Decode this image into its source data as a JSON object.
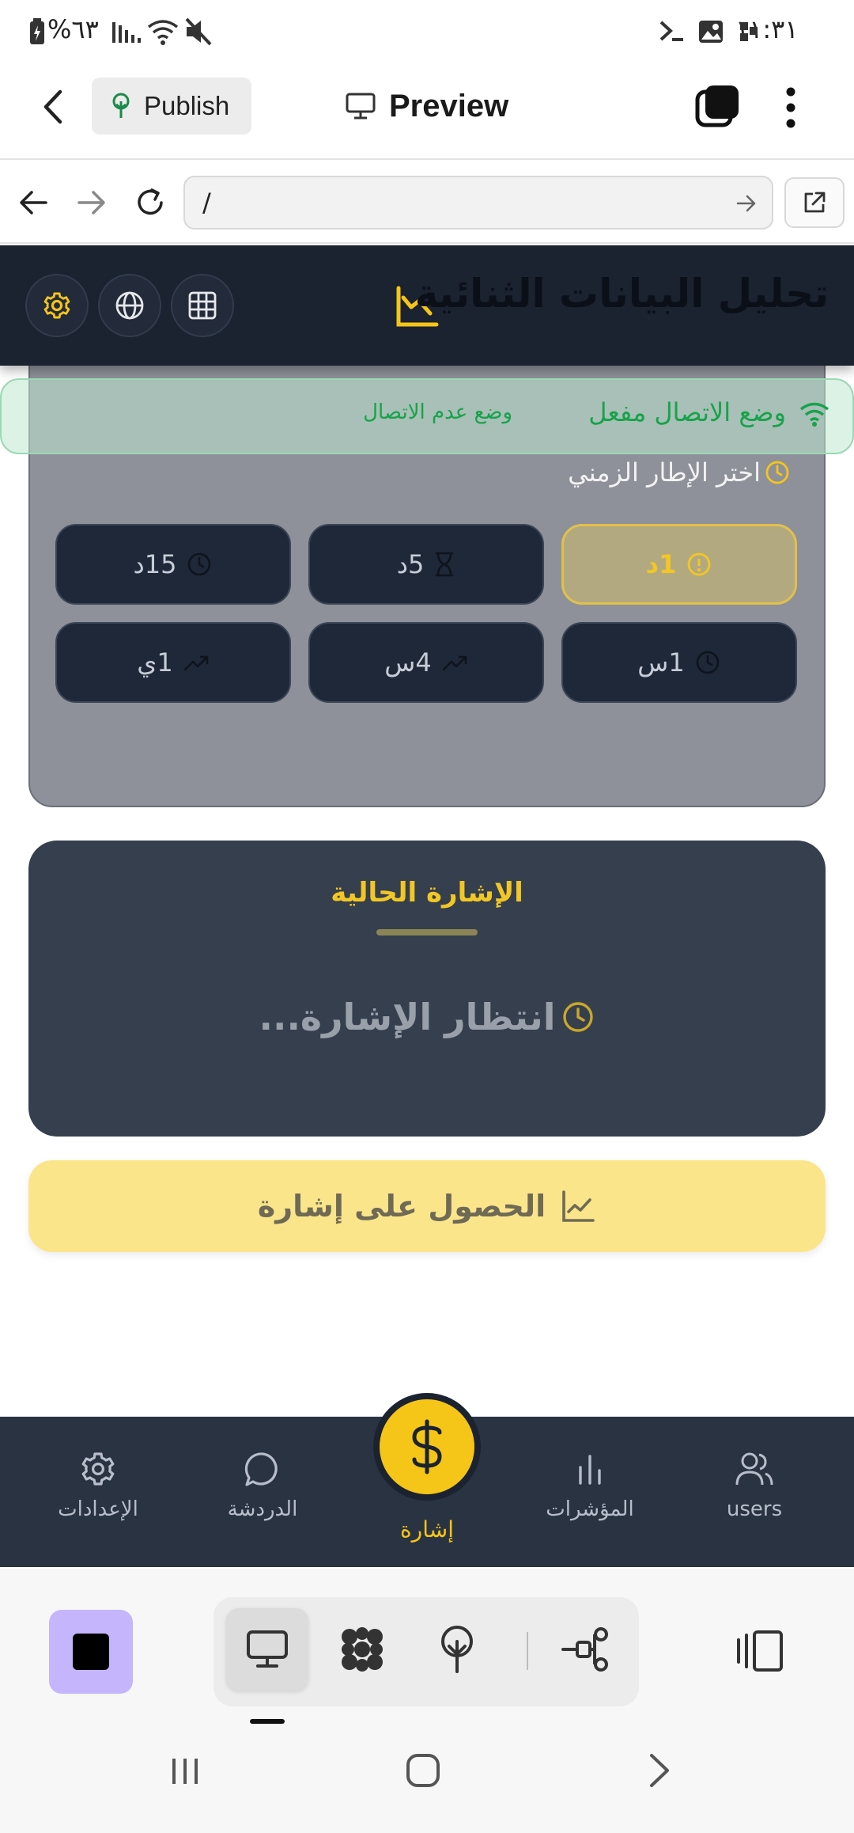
{
  "status_bar": {
    "time": "١١:٣١",
    "battery": "%٦٣"
  },
  "editor_header": {
    "publish_label": "Publish",
    "preview_label": "Preview"
  },
  "url_bar": {
    "value": "/"
  },
  "app": {
    "title": "تحليل البيانات الثنائية",
    "offline": {
      "enabled_text": "وضع الاتصال مفعل",
      "offline_text": "وضع عدم الاتصال"
    },
    "timeframe_label": "اختر الإطار الزمني",
    "timeframes": [
      {
        "label": "1د",
        "icon": "alert-circle-icon",
        "selected": true
      },
      {
        "label": "5د",
        "icon": "hourglass-icon",
        "selected": false
      },
      {
        "label": "15د",
        "icon": "clock-icon",
        "selected": false
      },
      {
        "label": "1س",
        "icon": "clock-icon",
        "selected": false
      },
      {
        "label": "4س",
        "icon": "trend-up-icon",
        "selected": false
      },
      {
        "label": "1ي",
        "icon": "trend-up-icon",
        "selected": false
      }
    ],
    "signal_card": {
      "title": "الإشارة الحالية",
      "waiting": "انتظار الإشارة..."
    },
    "get_signal_label": "الحصول على إشارة",
    "colors": {
      "accent": "#f5c518",
      "header_bg": "#1b2230",
      "card_bg": "#353f4d",
      "success": "#17a34a"
    }
  },
  "bottom_nav": {
    "items": [
      {
        "label": "users",
        "icon": "users-icon"
      },
      {
        "label": "المؤشرات",
        "icon": "bar-chart-icon"
      },
      {
        "label": "إشارة",
        "icon": "dollar-icon",
        "active": true
      },
      {
        "label": "الدردشة",
        "icon": "chat-icon"
      },
      {
        "label": "الإعدادات",
        "icon": "gear-icon"
      }
    ]
  }
}
